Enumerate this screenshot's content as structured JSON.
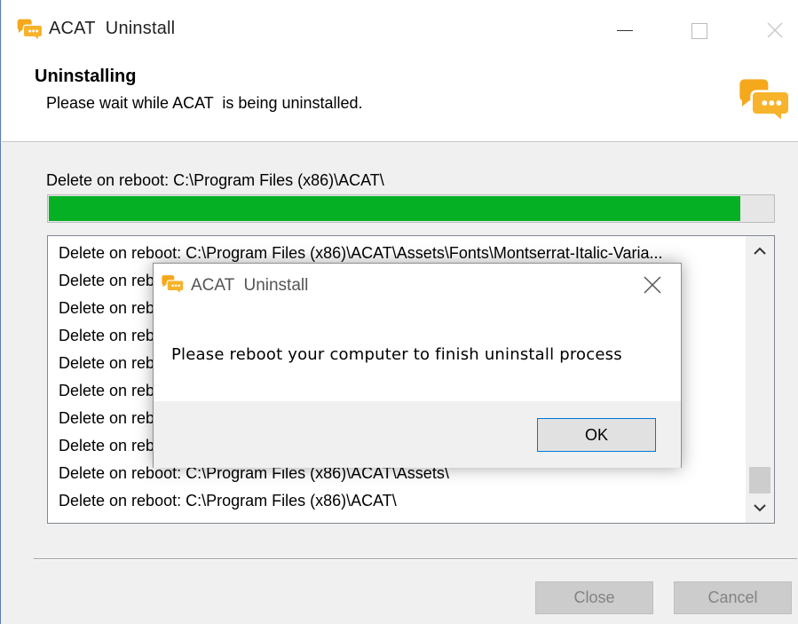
{
  "window": {
    "title": "ACAT  Uninstall",
    "icon": "speech-bubbles-icon",
    "controls": [
      "minimize-icon",
      "maximize-icon",
      "close-icon"
    ]
  },
  "header": {
    "title": "Uninstalling",
    "subtitle": "Please wait while ACAT  is being uninstalled.",
    "logo": "speech-bubbles-logo"
  },
  "status": {
    "label": "Delete on reboot: C:\\Program Files (x86)\\ACAT\\",
    "progress_fraction": 0.955
  },
  "details": {
    "items": [
      "Delete on reboot: C:\\Program Files (x86)\\ACAT\\Assets\\Fonts\\Montserrat-Italic-Varia...",
      "Delete on reboot: C:\\Program Files (x86)\\ACAT\\Assets\\Fonts\\Montserrat-VariableFo...",
      "Delete on reboot: C:\\Program Files (x86)\\ACAT\\Assets\\Fonts\\",
      "Delete on reboot: C:\\Program Files (x86)\\ACAT\\Assets\\Fonts\\",
      "Delete on reboot: C:\\Program Files (x86)\\ACAT\\Assets\\Fonts\\",
      "Delete on reboot: C:\\Program Files (x86)\\ACAT\\Assets\\Fonts\\Montserrat-Italic-Varia...",
      "Delete on reboot: C:\\Program Files (x86)\\ACAT\\Assets\\Fonts\\Montserrat-VariableFo...",
      "Delete on reboot: C:\\Program Files (x86)\\ACAT\\Assets\\Fonts\\",
      "Delete on reboot: C:\\Program Files (x86)\\ACAT\\Assets\\",
      "Delete on reboot: C:\\Program Files (x86)\\ACAT\\"
    ]
  },
  "buttons": {
    "close": "Close",
    "cancel": "Cancel"
  },
  "dialog": {
    "title": "ACAT  Uninstall",
    "message": "Please reboot your computer to finish uninstall process",
    "ok": "OK"
  },
  "colors": {
    "progress": "#06b025",
    "accent": "#0078d7",
    "icon_orange": "#f5a81c"
  }
}
